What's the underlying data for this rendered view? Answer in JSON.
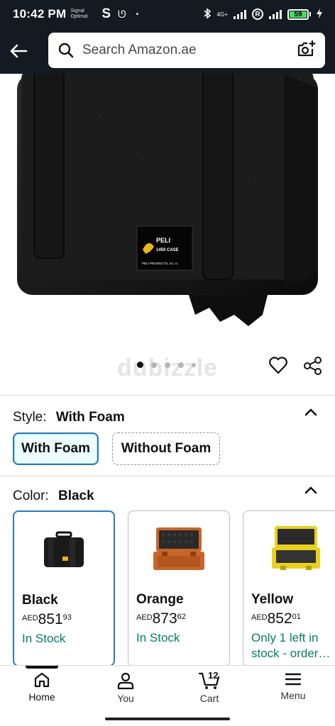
{
  "status_bar": {
    "time": "10:42 PM",
    "mini_text": "Signal Optimal",
    "battery_level": "59",
    "network": "4G+"
  },
  "header": {
    "search_placeholder": "Search Amazon.ae",
    "icons": [
      "back-arrow-icon",
      "search-icon",
      "camera-icon"
    ]
  },
  "gallery": {
    "image_count": 5,
    "active_index": 0,
    "watermark": "dubizzle",
    "label_brand": "PELI",
    "label_model": "1450 CASE",
    "label_maker": "PELI PRODUCTS, S.L.U."
  },
  "style_section": {
    "label": "Style:",
    "value": "With Foam",
    "options": [
      {
        "label": "With Foam",
        "selected": true
      },
      {
        "label": "Without Foam",
        "selected": false
      }
    ]
  },
  "color_section": {
    "label": "Color:",
    "value": "Black",
    "options": [
      {
        "name": "Black",
        "currency": "AED",
        "whole": "851",
        "fraction": "93",
        "stock": "In Stock",
        "swatch": "#1a1a1a",
        "selected": true
      },
      {
        "name": "Orange",
        "currency": "AED",
        "whole": "873",
        "fraction": "62",
        "stock": "In Stock",
        "swatch": "#c8662a",
        "selected": false
      },
      {
        "name": "Yellow",
        "currency": "AED",
        "whole": "852",
        "fraction": "01",
        "stock": "Only 1 left in stock - order…",
        "swatch": "#e8d21f",
        "selected": false
      }
    ]
  },
  "bottom_nav": {
    "items": [
      {
        "label": "Home",
        "icon": "home-icon",
        "active": true
      },
      {
        "label": "You",
        "icon": "user-icon",
        "active": false
      },
      {
        "label": "Cart",
        "icon": "cart-icon",
        "active": false,
        "count": "12"
      },
      {
        "label": "Menu",
        "icon": "menu-icon",
        "active": false
      }
    ]
  },
  "colors": {
    "header_bg": "#131a22",
    "selected_border": "#2a7bb2",
    "stock_green": "#067d62"
  }
}
